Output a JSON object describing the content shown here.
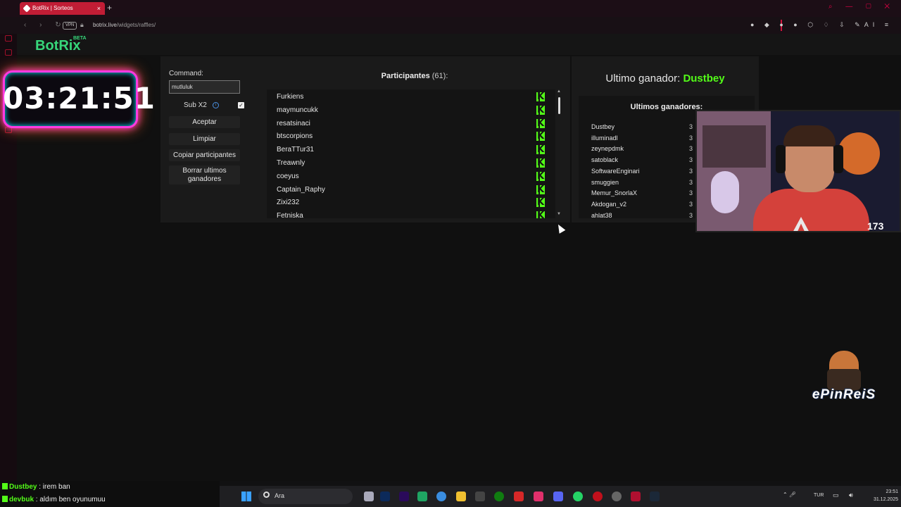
{
  "browser": {
    "tab_title": "BotRix | Sorteos",
    "tab_close": "×",
    "new_tab": "+",
    "vpn_label": "VPN",
    "url_host": "botrix.live",
    "url_path": "/widgets/raffles/",
    "ai_label": "AI"
  },
  "app": {
    "logo": "BotRix",
    "logo_badge": "BETA"
  },
  "raffle": {
    "command_label": "Command:",
    "command_value": "mutluluk",
    "sub_x2_label": "Sub X2",
    "sub_x2_checked": true,
    "buttons": {
      "accept": "Aceptar",
      "clear": "Limpiar",
      "copy_participants": "Copiar participantes",
      "clear_winners": "Borrar ultimos ganadores"
    },
    "participants_title": "Participantes",
    "participants_count": "(61):",
    "participants": [
      "Furkiens",
      "maymuncukk",
      "resatsinaci",
      "btscorpions",
      "BeraTTur31",
      "Treawnly",
      "coeyus",
      "Captain_Raphy",
      "Zixi232",
      "Fetniska"
    ],
    "last_winner_label": "Ultimo ganador:",
    "last_winner_name": "Dustbey",
    "winners_title": "Ultimos ganadores:",
    "winners": [
      {
        "name": "Dustbey",
        "date": "3"
      },
      {
        "name": "illuminadl",
        "date": "3"
      },
      {
        "name": "zeynepdmk",
        "date": "3"
      },
      {
        "name": "satoblack",
        "date": "3"
      },
      {
        "name": "SoftwareEnginari",
        "date": "3"
      },
      {
        "name": "smuggien",
        "date": "3"
      },
      {
        "name": "Memur_SnorlaX",
        "date": "3"
      },
      {
        "name": "Akdogan_v2",
        "date": "3"
      },
      {
        "name": "ahlat38",
        "date": "3"
      }
    ]
  },
  "overlay": {
    "timer": "03:21:51",
    "viewer_count": "173",
    "mascot_text": "ePinReiS"
  },
  "chat": [
    {
      "user": "Dustbey",
      "message": " : irem ban"
    },
    {
      "user": "devbuk",
      "message": " : aldım ben oyunumuu"
    }
  ],
  "taskbar": {
    "search_placeholder": "Ara",
    "language": "TUR",
    "time": "23:51",
    "date": "31.12.2025"
  },
  "colors": {
    "accent_green": "#53fc18",
    "logo_green": "#37d67a",
    "tab_red": "#c11d35"
  }
}
